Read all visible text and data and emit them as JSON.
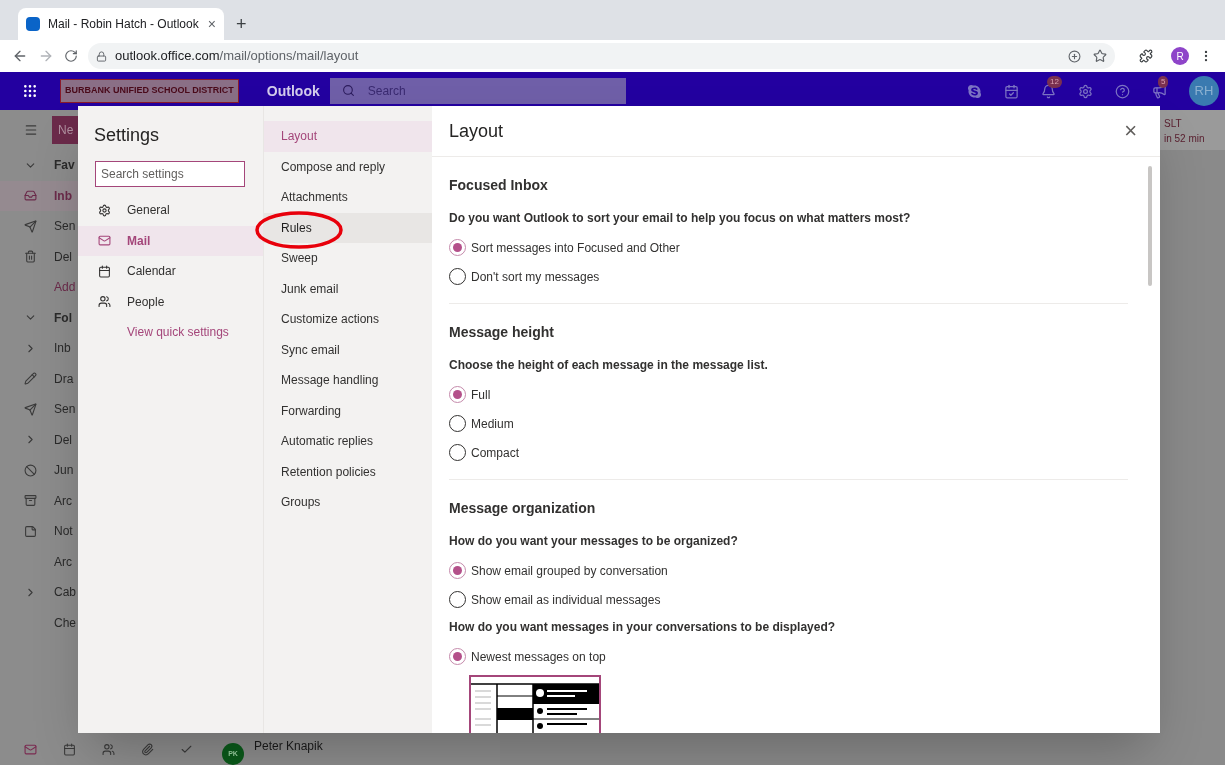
{
  "browser": {
    "tab": {
      "title": "Mail - Robin Hatch - Outlook",
      "close": "×",
      "new_tab": "+"
    },
    "address": {
      "host": "outlook.office.com",
      "path": "/mail/options/mail/layout"
    },
    "profile_initial": "R"
  },
  "header": {
    "org": "BURBANK UNIFIED SCHOOL DISTRICT",
    "app": "Outlook",
    "search": {
      "placeholder": "Search"
    },
    "notifications": "12",
    "announcements": "5",
    "avatar": "RH"
  },
  "background_nav": {
    "new_button": "Ne",
    "items": [
      {
        "kind": "chevron-down",
        "label": "Fav",
        "selected": false
      },
      {
        "kind": "inbox",
        "label": "Inb",
        "selected": true
      },
      {
        "kind": "send",
        "label": "Sen",
        "selected": false
      },
      {
        "kind": "trash",
        "label": "Del",
        "selected": false
      },
      {
        "kind": "link",
        "label": "Add",
        "selected": false
      },
      {
        "kind": "chevron-down",
        "label": "Fol",
        "selected": false
      },
      {
        "kind": "chevron-right",
        "label": "Inb",
        "selected": false
      },
      {
        "kind": "pencil",
        "label": "Dra",
        "selected": false
      },
      {
        "kind": "send",
        "label": "Sen",
        "selected": false
      },
      {
        "kind": "chevron-right",
        "label": "Del",
        "selected": false
      },
      {
        "kind": "block",
        "label": "Jun",
        "selected": false
      },
      {
        "kind": "archive",
        "label": "Arc",
        "selected": false
      },
      {
        "kind": "note",
        "label": "Not",
        "selected": false
      },
      {
        "kind": "none",
        "label": "Arc",
        "selected": false
      },
      {
        "kind": "chevron-right",
        "label": "Cab",
        "selected": false
      },
      {
        "kind": "none",
        "label": "Che",
        "selected": false
      }
    ]
  },
  "bottom_bar": {
    "apps": [
      {
        "kind": "mail",
        "selected": true
      },
      {
        "kind": "calendar",
        "selected": false
      },
      {
        "kind": "people",
        "selected": false
      },
      {
        "kind": "attachment",
        "selected": false
      },
      {
        "kind": "tasks",
        "selected": false
      }
    ],
    "message": {
      "avatar": "PK",
      "sender": "Peter Knapik"
    }
  },
  "reminder": {
    "title": "SLT",
    "time": "in 52 min"
  },
  "settings": {
    "title": "Settings",
    "search": {
      "placeholder": "Search settings"
    },
    "categories": [
      {
        "kind": "gear",
        "label": "General",
        "selected": false
      },
      {
        "kind": "mail",
        "label": "Mail",
        "selected": true
      },
      {
        "kind": "calendar",
        "label": "Calendar",
        "selected": false
      },
      {
        "kind": "people",
        "label": "People",
        "selected": false
      }
    ],
    "quick_link": "View quick settings"
  },
  "subnav": [
    {
      "label": "Layout",
      "selected": true,
      "hovered": false
    },
    {
      "label": "Compose and reply",
      "selected": false,
      "hovered": false
    },
    {
      "label": "Attachments",
      "selected": false,
      "hovered": false
    },
    {
      "label": "Rules",
      "selected": false,
      "hovered": true
    },
    {
      "label": "Sweep",
      "selected": false,
      "hovered": false
    },
    {
      "label": "Junk email",
      "selected": false,
      "hovered": false
    },
    {
      "label": "Customize actions",
      "selected": false,
      "hovered": false
    },
    {
      "label": "Sync email",
      "selected": false,
      "hovered": false
    },
    {
      "label": "Message handling",
      "selected": false,
      "hovered": false
    },
    {
      "label": "Forwarding",
      "selected": false,
      "hovered": false
    },
    {
      "label": "Automatic replies",
      "selected": false,
      "hovered": false
    },
    {
      "label": "Retention policies",
      "selected": false,
      "hovered": false
    },
    {
      "label": "Groups",
      "selected": false,
      "hovered": false
    }
  ],
  "content": {
    "title": "Layout",
    "close": "×",
    "sections": [
      {
        "heading": "Focused Inbox",
        "questions": [
          {
            "question": "Do you want Outlook to sort your email to help you focus on what matters most?",
            "options": [
              {
                "label": "Sort messages into Focused and Other",
                "selected": true
              },
              {
                "label": "Don't sort my messages",
                "selected": false
              }
            ]
          }
        ]
      },
      {
        "heading": "Message height",
        "questions": [
          {
            "question": "Choose the height of each message in the message list.",
            "options": [
              {
                "label": "Full",
                "selected": true
              },
              {
                "label": "Medium",
                "selected": false
              },
              {
                "label": "Compact",
                "selected": false
              }
            ]
          }
        ]
      },
      {
        "heading": "Message organization",
        "questions": [
          {
            "question": "How do you want your messages to be organized?",
            "options": [
              {
                "label": "Show email grouped by conversation",
                "selected": true
              },
              {
                "label": "Show email as individual messages",
                "selected": false
              }
            ]
          },
          {
            "question": "How do you want messages in your conversations to be displayed?",
            "options": [
              {
                "label": "Newest messages on top",
                "selected": true,
                "preview": true
              }
            ]
          }
        ]
      }
    ]
  }
}
